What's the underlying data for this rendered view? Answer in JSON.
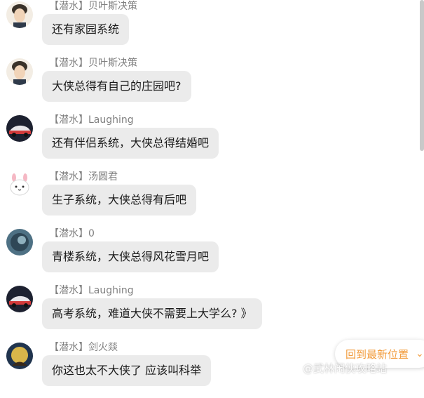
{
  "messages": [
    {
      "meta": "【潜水】贝叶斯决策",
      "text": "还有家园系统"
    },
    {
      "meta": "【潜水】贝叶斯决策",
      "text": "大侠总得有自己的庄园吧?"
    },
    {
      "meta": "【潜水】Laughing",
      "text": "还有伴侣系统，大侠总得结婚吧"
    },
    {
      "meta": "【潜水】汤圆君",
      "text": "生子系统，大侠总得有后吧"
    },
    {
      "meta": "【潜水】0",
      "text": "青楼系统，大侠总得风花雪月吧"
    },
    {
      "meta": "【潜水】Laughing",
      "text": "高考系统，难道大侠不需要上大学么? 》"
    },
    {
      "meta": "【潜水】剑火燚",
      "text": "你这也太不大侠了 应该叫科举"
    }
  ],
  "jump_button": {
    "label": "回到最新位置",
    "chevron": "⌄"
  },
  "watermark": "@武林闲侠攻略站"
}
